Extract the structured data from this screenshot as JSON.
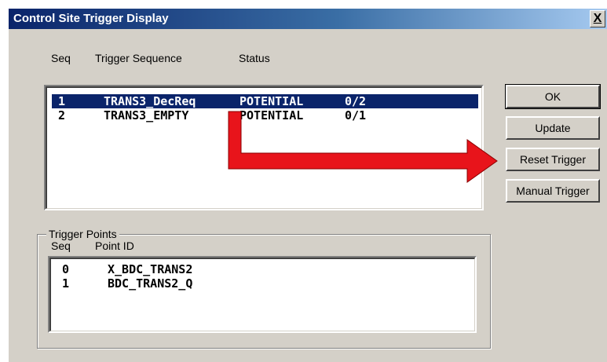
{
  "window": {
    "title": "Control Site Trigger Display",
    "close_label": "X"
  },
  "sequence_list": {
    "headers": {
      "seq": "Seq",
      "trigger_sequence": "Trigger Sequence",
      "status": "Status"
    },
    "rows": [
      {
        "seq": "1",
        "name": "TRANS3_DecReq",
        "status": "POTENTIAL",
        "count": "0/2",
        "selected": true
      },
      {
        "seq": "2",
        "name": "TRANS3_EMPTY",
        "status": "POTENTIAL",
        "count": "0/1",
        "selected": false
      }
    ]
  },
  "buttons": {
    "ok": "OK",
    "update": "Update",
    "reset_trigger": "Reset Trigger",
    "manual_trigger": "Manual Trigger"
  },
  "trigger_points": {
    "group_label": "Trigger Points",
    "headers": {
      "seq": "Seq",
      "point_id": "Point ID"
    },
    "rows": [
      {
        "seq": "0",
        "point_id": "X_BDC_TRANS2"
      },
      {
        "seq": "1",
        "point_id": "BDC_TRANS2_Q"
      }
    ]
  },
  "annotation": {
    "arrow_color": "#e8141b",
    "arrow_target": "Reset Trigger"
  },
  "colors": {
    "title_bar": "#0a246a",
    "selection": "#0a246a",
    "dialog_background": "#d4d0c8"
  }
}
